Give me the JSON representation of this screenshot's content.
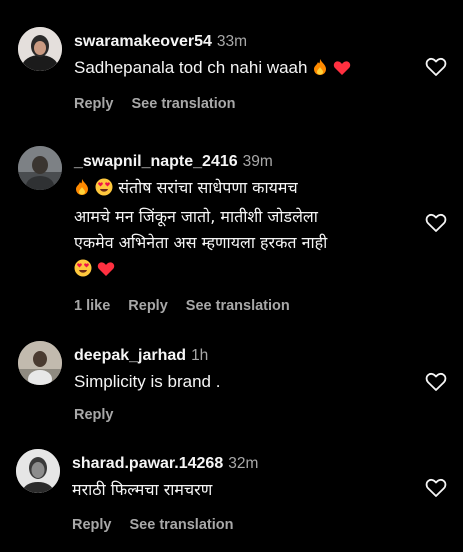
{
  "comments": [
    {
      "username": "swaramakeover54",
      "time": "33m",
      "text": "Sadhepanala tod ch nahi waah",
      "emojis": [
        "fire",
        "red-heart"
      ],
      "likes": "",
      "reply_label": "Reply",
      "translate_label": "See translation"
    },
    {
      "username": "_swapnil_napte_2416",
      "time": "39m",
      "text_lines": [
        "संतोष सरांचा साधेपणा कायमच",
        "आमचे मन जिंकून जातो, मातीशी जोडलेला",
        "एकमेव अभिनेता अस म्हणायला हरकत नाही"
      ],
      "emojis_lead": [
        "fire",
        "heart-eyes"
      ],
      "emojis_trail": [
        "heart-eyes",
        "red-heart"
      ],
      "likes": "1 like",
      "reply_label": "Reply",
      "translate_label": "See translation"
    },
    {
      "username": "deepak_jarhad",
      "time": "1h",
      "text": "Simplicity is brand .",
      "likes": "",
      "reply_label": "Reply",
      "translate_label": ""
    },
    {
      "username": "sharad.pawar.14268",
      "time": "32m",
      "text": "मराठी फिल्मचा रामचरण",
      "likes": "",
      "reply_label": "Reply",
      "translate_label": "See translation"
    }
  ],
  "colors": {
    "background": "#000000",
    "primary_text": "#f5f5f5",
    "secondary_text": "#a8a8a8",
    "heart_red": "#ff3040",
    "fire_orange": "#ff8a00"
  },
  "icons": [
    "heart-outline-icon",
    "fire-emoji",
    "red-heart-emoji",
    "heart-eyes-emoji"
  ]
}
